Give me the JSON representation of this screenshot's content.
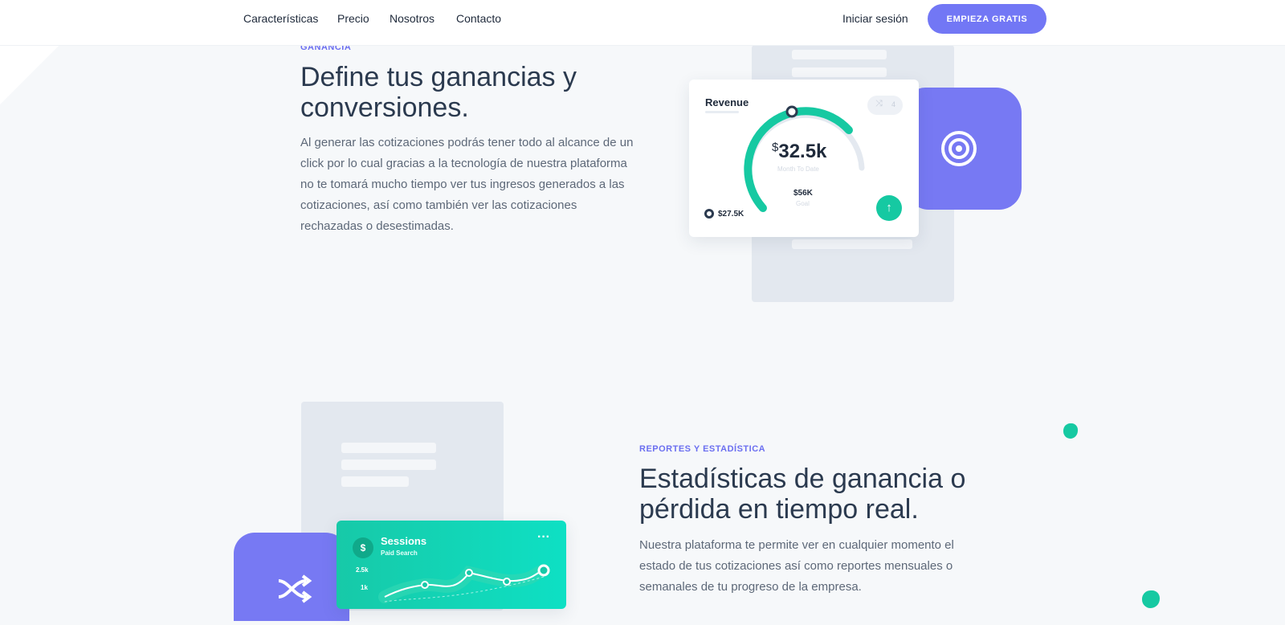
{
  "nav": {
    "links": [
      "Características",
      "Precio",
      "Nosotros",
      "Contacto"
    ],
    "login": "Iniciar sesión",
    "cta": "EMPIEZA GRATIS"
  },
  "section1": {
    "eyebrow": "GANANCIA",
    "title_line1": "Define tus ganancias y",
    "title_line2": "conversiones.",
    "body": [
      "Al generar las cotizaciones podrás tener todo al alcance de un",
      "click por lo cual gracias a la tecnología de nuestra plataforma",
      "no te tomará mucho tiempo ver tus ingresos generados a las",
      "cotizaciones, así como también ver las cotizaciones",
      "rechazadas o desestimadas."
    ],
    "card": {
      "title": "Revenue",
      "badge_count": "4",
      "currency": "$",
      "value": "32.5k",
      "subtitle": "Month To Date",
      "goal_value": "$56K",
      "goal_label": "Goal",
      "start_value": "$27.5K"
    }
  },
  "section2": {
    "eyebrow": "REPORTES Y ESTADÍSTICA",
    "title_line1": "Estadísticas de ganancia o",
    "title_line2": "pérdida en tiempo real.",
    "body": [
      "Nuestra plataforma te permite ver en cualquier momento el",
      "estado de tus cotizaciones así como reportes mensuales o",
      "semanales de tu progreso de la empresa."
    ],
    "card": {
      "currency_icon": "$",
      "title": "Sessions",
      "subtitle": "Paid Search",
      "tick_high": "2.5k",
      "tick_low": "1k"
    }
  },
  "colors": {
    "accent": "#7277f5",
    "teal": "#16c9a2",
    "panel": "#e3e8ef"
  }
}
